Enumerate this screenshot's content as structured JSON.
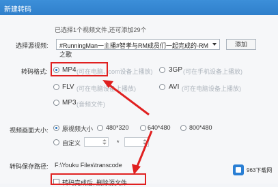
{
  "window": {
    "title": "新建转码"
  },
  "info": {
    "text": "已选择1个视频文件,还可添加29个"
  },
  "source": {
    "label": "选择源视频:",
    "value": "#RunningMan一主播#智孝与RM成员们一起完成的-RM之歌",
    "add_button": "添加"
  },
  "format": {
    "label": "转码格式:",
    "options": [
      {
        "name": "MP4",
        "note": "(可在电脑、",
        "note2": ".com设备上播放)",
        "selected": true
      },
      {
        "name": "3GP",
        "note": "(可在手机设备上播放)",
        "selected": false
      },
      {
        "name": "FLV",
        "note": "(可在电脑设备上播放)",
        "selected": false
      },
      {
        "name": "AVI",
        "note": "(可在电脑设备上播放)",
        "selected": false
      },
      {
        "name": "MP3",
        "note": "(音频文件)",
        "selected": false
      }
    ]
  },
  "size": {
    "label": "视频画面大小:",
    "options": [
      {
        "name": "原视频大小",
        "selected": true
      },
      {
        "name": "480*320",
        "selected": false
      },
      {
        "name": "640*480",
        "selected": false
      },
      {
        "name": "800*480",
        "selected": false
      }
    ],
    "custom_label": "自定义",
    "times": "*"
  },
  "save": {
    "label": "转码保存路径:",
    "path": "F:\\Youku Files\\transcode"
  },
  "delete_option": {
    "label": "转码完成后, 删除源文件",
    "checked": false
  },
  "watermark": {
    "text": "963下载网"
  },
  "colors": {
    "title_bar": "#2f7fcb",
    "highlight": "#e02020",
    "accent_blue": "#1f6fbf"
  }
}
